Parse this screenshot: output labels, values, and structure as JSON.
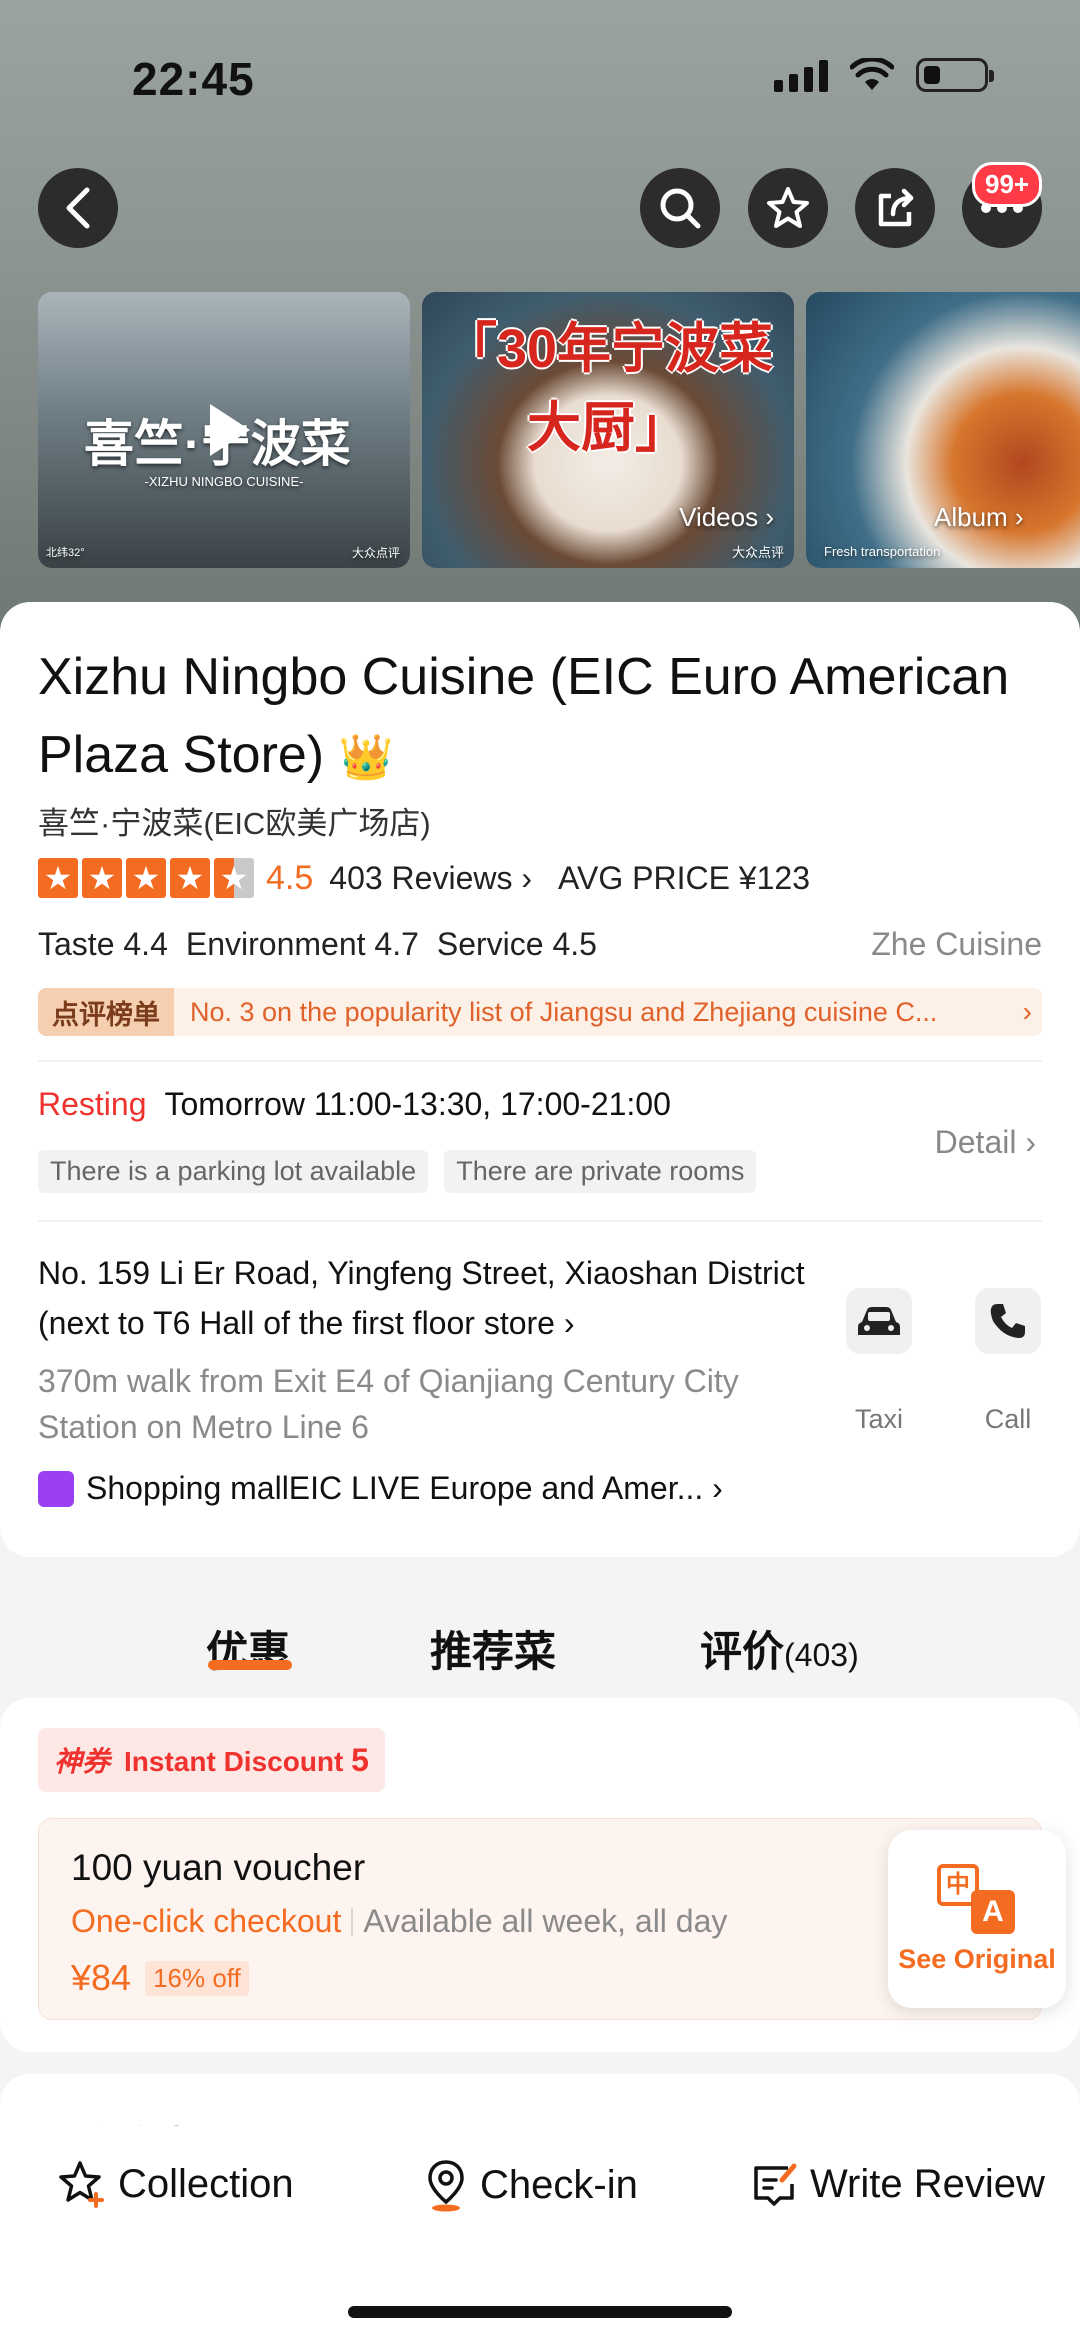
{
  "status_bar": {
    "time": "22:45"
  },
  "header": {
    "notification_badge": "99+"
  },
  "media": {
    "video_caption": "喜竺·宁波菜",
    "video_sub": "-XIZHU NINGBO CUISINE-",
    "video_geo": "北纬32°",
    "video_watermark": "大众点评",
    "dish_title": "「30年宁波菜大厨」",
    "dish_watermark": "大众点评",
    "videos_label": "Videos",
    "album_label": "Album",
    "m3_caption": "Fresh transportation"
  },
  "restaurant": {
    "name": "Xizhu Ningbo Cuisine (EIC Euro American Plaza Store)",
    "name_cn": "喜竺·宁波菜(EIC欧美广场店)",
    "rating": "4.5",
    "reviews": "403 Reviews",
    "avg_price": "AVG PRICE ¥123",
    "scores": [
      "Taste 4.4",
      "Environment 4.7",
      "Service 4.5"
    ],
    "cuisine": "Zhe Cuisine",
    "rank_tag": "点评榜单",
    "rank_text": "No. 3 on the popularity list of Jiangsu and Zhejiang cuisine C...",
    "status": "Resting",
    "hours": "Tomorrow 11:00-13:30, 17:00-21:00",
    "tags": [
      "There is a parking lot available",
      "There are private rooms"
    ],
    "detail_label": "Detail",
    "address": "No. 159 Li Er Road, Yingfeng Street, Xiaoshan District (next to T6 Hall of the first floor store",
    "walk": "370m walk from Exit E4 of Qianjiang Century City Station on Metro Line 6",
    "taxi_label": "Taxi",
    "call_label": "Call",
    "mall_prefix": "Shopping mall",
    "mall_name": "EIC LIVE Europe and Amer..."
  },
  "tabs": [
    {
      "label": "优惠"
    },
    {
      "label": "推荐菜"
    },
    {
      "label": "评价",
      "count": "(403)"
    }
  ],
  "deal": {
    "badge_cn": "神券",
    "discount_label": "Instant Discount",
    "discount_value": "5",
    "voucher_title": "100 yuan voucher",
    "oneclick": "One-click checkout",
    "availability": "Available all week, all day",
    "price": "¥84",
    "off": "16% off"
  },
  "see_original": {
    "label": "See Original"
  },
  "next_section": "到店套餐",
  "bottom_bar": {
    "collection": "Collection",
    "checkin": "Check-in",
    "write_review": "Write Review"
  },
  "colors": {
    "accent": "#f36c21",
    "alert": "#f0322f"
  }
}
